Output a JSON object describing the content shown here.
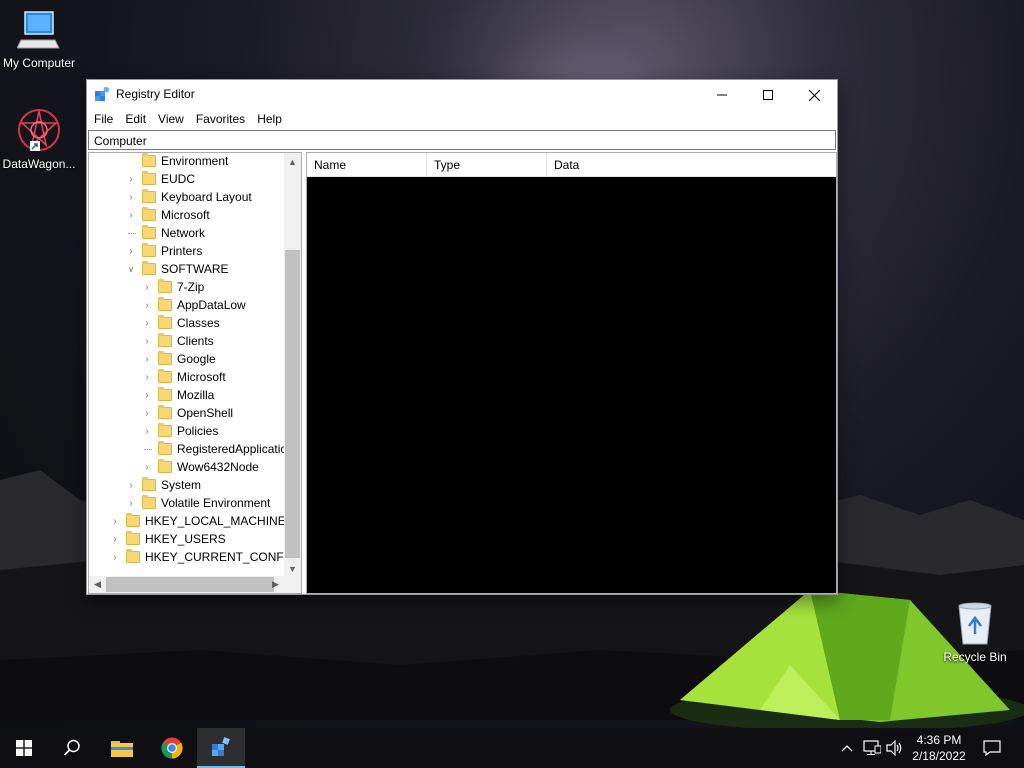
{
  "desktop": {
    "icons": [
      {
        "label": "My Computer",
        "icon": "computer-icon"
      },
      {
        "label": "DataWagon...",
        "icon": "datawagon-shortcut-icon"
      },
      {
        "label": "Recycle Bin",
        "icon": "recycle-bin-icon"
      }
    ]
  },
  "window": {
    "title": "Registry Editor",
    "menu": [
      "File",
      "Edit",
      "View",
      "Favorites",
      "Help"
    ],
    "address": "Computer",
    "tree": [
      {
        "label": "Environment",
        "expander": "none"
      },
      {
        "label": "EUDC",
        "expander": "collapsed"
      },
      {
        "label": "Keyboard Layout",
        "expander": "collapsed"
      },
      {
        "label": "Microsoft",
        "expander": "collapsed"
      },
      {
        "label": "Network",
        "expander": "none"
      },
      {
        "label": "Printers",
        "expander": "collapsed"
      },
      {
        "label": "SOFTWARE",
        "expander": "expanded"
      },
      {
        "label": "7-Zip",
        "expander": "collapsed"
      },
      {
        "label": "AppDataLow",
        "expander": "collapsed"
      },
      {
        "label": "Classes",
        "expander": "collapsed"
      },
      {
        "label": "Clients",
        "expander": "collapsed"
      },
      {
        "label": "Google",
        "expander": "collapsed"
      },
      {
        "label": "Microsoft",
        "expander": "collapsed"
      },
      {
        "label": "Mozilla",
        "expander": "collapsed"
      },
      {
        "label": "OpenShell",
        "expander": "collapsed"
      },
      {
        "label": "Policies",
        "expander": "collapsed"
      },
      {
        "label": "RegisteredApplications",
        "expander": "none"
      },
      {
        "label": "Wow6432Node",
        "expander": "collapsed"
      },
      {
        "label": "System",
        "expander": "collapsed"
      },
      {
        "label": "Volatile Environment",
        "expander": "collapsed"
      },
      {
        "label": "HKEY_LOCAL_MACHINE",
        "expander": "collapsed"
      },
      {
        "label": "HKEY_USERS",
        "expander": "collapsed"
      },
      {
        "label": "HKEY_CURRENT_CONFIG",
        "expander": "collapsed"
      }
    ],
    "columns": [
      "Name",
      "Type",
      "Data"
    ]
  },
  "taskbar": {
    "items": [
      "start-icon",
      "search-icon",
      "file-explorer-icon",
      "chrome-icon",
      "registry-editor-icon"
    ],
    "active": "registry-editor-icon",
    "time": "4:36 PM",
    "date": "2/18/2022"
  }
}
